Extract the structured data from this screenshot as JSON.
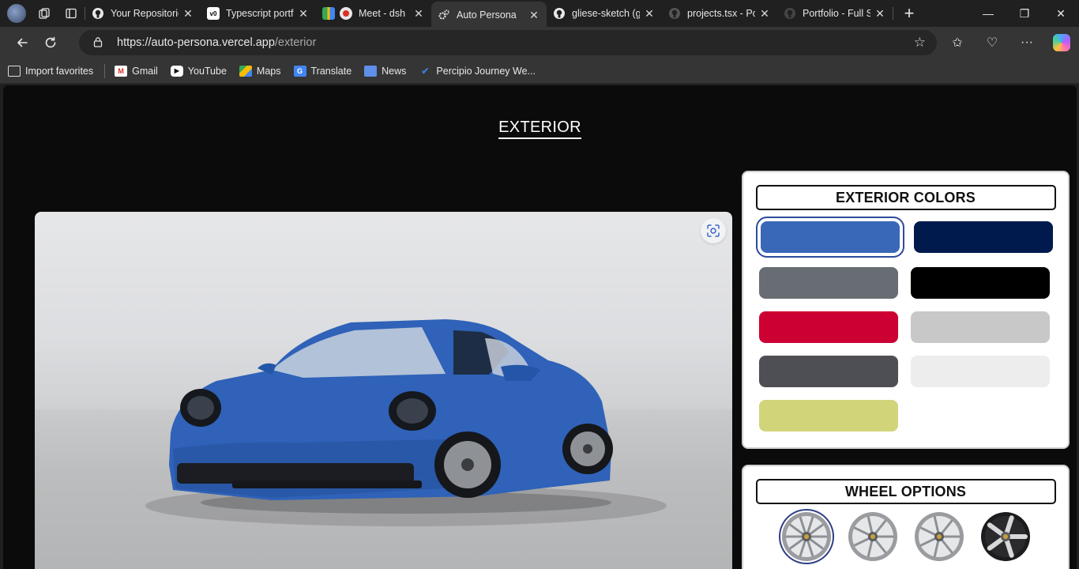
{
  "browser": {
    "tabs": [
      {
        "title": "Your Repositories",
        "favicon": "github-icon",
        "active": false
      },
      {
        "title": "Typescript portfolio",
        "favicon": "v0-icon",
        "active": false
      },
      {
        "title": "Meet - dsh",
        "favicon": "google-meet-icon",
        "active": false
      },
      {
        "title": "Auto Persona",
        "favicon": "gears-icon",
        "active": true
      },
      {
        "title": "gliese-sketch (g",
        "favicon": "github-icon",
        "active": false
      },
      {
        "title": "projects.tsx - Po",
        "favicon": "github-icon",
        "active": false
      },
      {
        "title": "Portfolio - Full S",
        "favicon": "github-icon",
        "active": false
      }
    ],
    "address": {
      "host": "https://auto-persona.vercel.app",
      "path": "/exterior"
    },
    "bookmarks": [
      {
        "label": "Import favorites",
        "icon": "import-icon"
      },
      {
        "label": "Gmail",
        "icon": "gmail-icon"
      },
      {
        "label": "YouTube",
        "icon": "youtube-icon"
      },
      {
        "label": "Maps",
        "icon": "maps-icon"
      },
      {
        "label": "Translate",
        "icon": "translate-icon"
      },
      {
        "label": "News",
        "icon": "news-icon"
      },
      {
        "label": "Percipio Journey We...",
        "icon": "percipio-icon"
      }
    ]
  },
  "page": {
    "title": "EXTERIOR",
    "car_color": "#2f62b8",
    "exterior_colors": {
      "heading": "EXTERIOR COLORS",
      "swatches": [
        {
          "color": "#3a68b8",
          "selected": true
        },
        {
          "color": "#001a4d",
          "selected": false
        },
        {
          "color": "#686c73",
          "selected": false
        },
        {
          "color": "#000000",
          "selected": false
        },
        {
          "color": "#cc0033",
          "selected": false
        },
        {
          "color": "#c8c8c8",
          "selected": false
        },
        {
          "color": "#4e4f54",
          "selected": false
        },
        {
          "color": "#ededee",
          "selected": false
        },
        {
          "color": "#d2d47a",
          "selected": false
        }
      ]
    },
    "wheel_options": {
      "heading": "WHEEL OPTIONS",
      "wheels": [
        {
          "name": "wheel-option-1",
          "style": "silver-multispoke",
          "selected": true
        },
        {
          "name": "wheel-option-2",
          "style": "silver-split-spoke",
          "selected": false
        },
        {
          "name": "wheel-option-3",
          "style": "silver-turbine",
          "selected": false
        },
        {
          "name": "wheel-option-4",
          "style": "black-silver-five-spoke",
          "selected": false
        }
      ]
    }
  }
}
